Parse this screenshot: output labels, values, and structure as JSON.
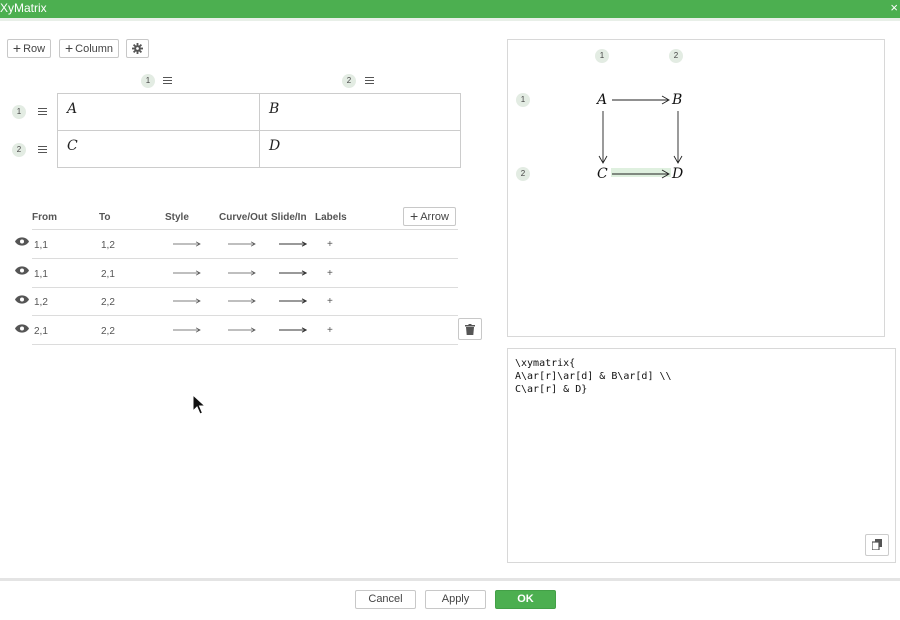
{
  "window": {
    "title": "XyMatrix",
    "close_glyph": "×"
  },
  "toolbar": {
    "add_row_label": "Row",
    "add_column_label": "Column",
    "settings_icon": "gear-icon",
    "plus_glyph": "+"
  },
  "matrix": {
    "column_badges": [
      "1",
      "2"
    ],
    "row_badges": [
      "1",
      "2"
    ],
    "cells": [
      [
        "A",
        "B"
      ],
      [
        "C",
        "D"
      ]
    ]
  },
  "arrows": {
    "headers": {
      "from": "From",
      "to": "To",
      "style": "Style",
      "curve_out": "Curve/Out",
      "slide_in": "Slide/In",
      "labels": "Labels"
    },
    "add_arrow_label": "Arrow",
    "rows": [
      {
        "from": "1,1",
        "to": "1,2",
        "labels": "+"
      },
      {
        "from": "1,1",
        "to": "2,1",
        "labels": "+"
      },
      {
        "from": "1,2",
        "to": "2,2",
        "labels": "+"
      },
      {
        "from": "2,1",
        "to": "2,2",
        "labels": "+"
      }
    ],
    "delete_icon": "trash-icon",
    "visibility_icon": "eye-icon"
  },
  "preview": {
    "column_badges": [
      "1",
      "2"
    ],
    "row_badges": [
      "1",
      "2"
    ],
    "nodes": [
      "A",
      "B",
      "C",
      "D"
    ]
  },
  "code": {
    "lines": [
      "\\xymatrix{",
      "A\\ar[r]\\ar[d] & B\\ar[d] \\\\",
      "C\\ar[r] & D}"
    ],
    "copy_icon": "copy-icon"
  },
  "footer": {
    "cancel_label": "Cancel",
    "apply_label": "Apply",
    "ok_label": "OK"
  },
  "colors": {
    "accent": "#4caf50",
    "badge_bg": "#e3ece3",
    "highlight": "#dff0df"
  }
}
